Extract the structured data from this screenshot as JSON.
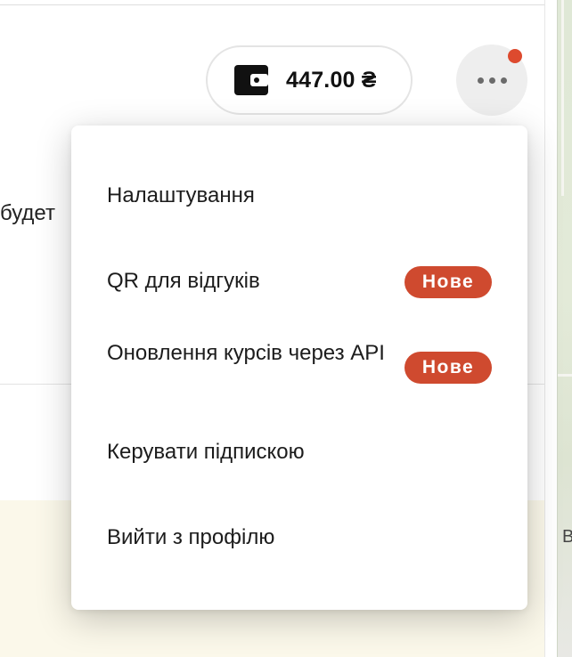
{
  "background": {
    "partial_text": "будет",
    "map_label": "В"
  },
  "header": {
    "balance": "447.00 ₴",
    "wallet_icon": "wallet-icon",
    "more_icon": "more-horizontal-icon",
    "has_notification": true
  },
  "menu": {
    "items": [
      {
        "label": "Налаштування",
        "badge": ""
      },
      {
        "label": "QR для відгуків",
        "badge": "Нове"
      },
      {
        "label": "Оновлення курсів через API",
        "badge": "Нове"
      },
      {
        "label": "Керувати підпискою",
        "badge": ""
      },
      {
        "label": "Вийти з профілю",
        "badge": ""
      }
    ]
  },
  "colors": {
    "badge": "#cf4a2f",
    "notification": "#dd4a2e",
    "cream": "#fbf8ea"
  }
}
